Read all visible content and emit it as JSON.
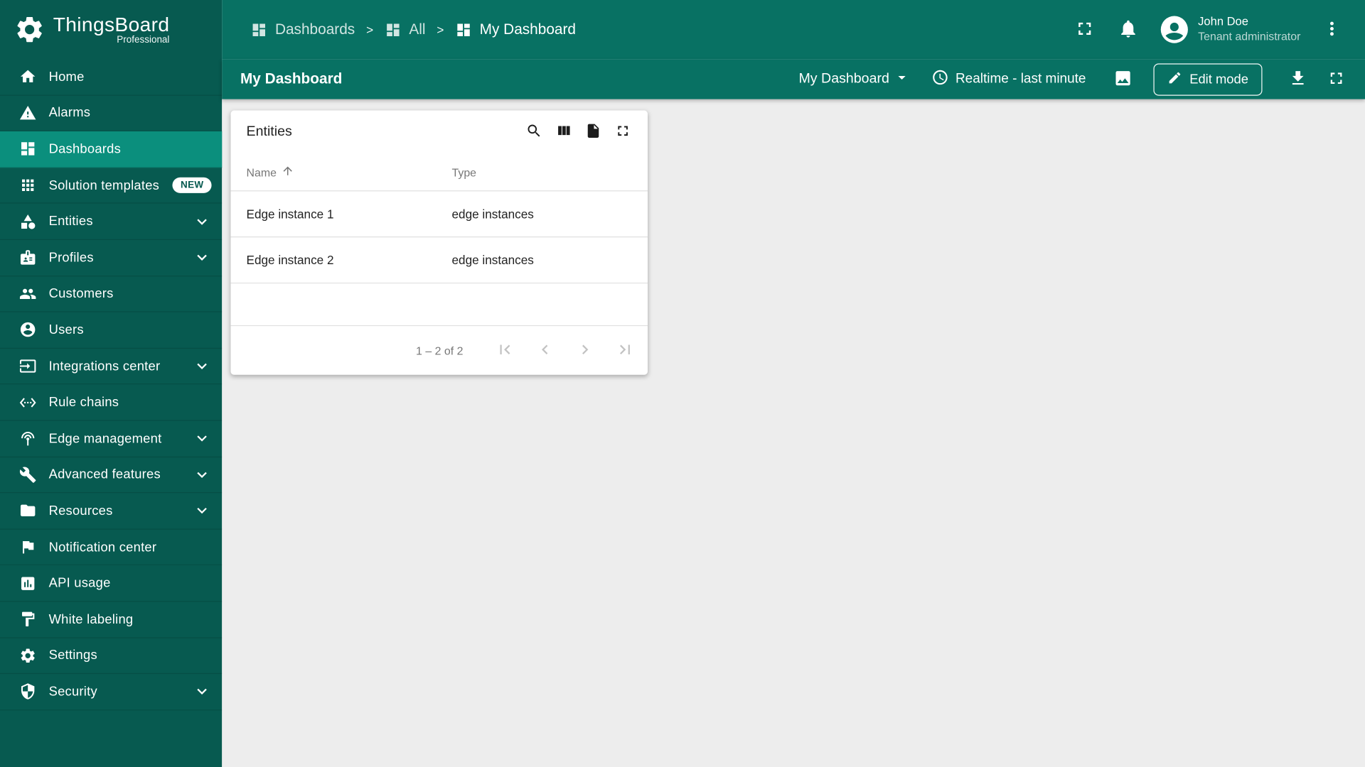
{
  "colors": {
    "sidebar_bg": "#075a50",
    "topbar_bg": "#087163",
    "active_bg": "#0b8f7d",
    "content_bg": "#ededed",
    "badge_text": "#075a50"
  },
  "app": {
    "logo_title": "ThingsBoard",
    "logo_subtitle": "Professional"
  },
  "sidebar": {
    "items": [
      {
        "label": "Home"
      },
      {
        "label": "Alarms"
      },
      {
        "label": "Dashboards"
      },
      {
        "label": "Solution templates",
        "badge": "NEW"
      },
      {
        "label": "Entities"
      },
      {
        "label": "Profiles"
      },
      {
        "label": "Customers"
      },
      {
        "label": "Users"
      },
      {
        "label": "Integrations center"
      },
      {
        "label": "Rule chains"
      },
      {
        "label": "Edge management"
      },
      {
        "label": "Advanced features"
      },
      {
        "label": "Resources"
      },
      {
        "label": "Notification center"
      },
      {
        "label": "API usage"
      },
      {
        "label": "White labeling"
      },
      {
        "label": "Settings"
      },
      {
        "label": "Security"
      }
    ]
  },
  "breadcrumb": {
    "separator": ">",
    "items": [
      {
        "label": "Dashboards"
      },
      {
        "label": "All"
      },
      {
        "label": "My Dashboard"
      }
    ]
  },
  "user": {
    "name": "John Doe",
    "role": "Tenant administrator"
  },
  "toolbar": {
    "title": "My Dashboard",
    "dashboard_selector": "My Dashboard",
    "timewindow": "Realtime - last minute",
    "edit_button": "Edit mode"
  },
  "widget": {
    "title": "Entities",
    "columns": {
      "name": "Name",
      "type": "Type"
    },
    "rows": [
      {
        "name": "Edge instance 1",
        "type": "edge instances"
      },
      {
        "name": "Edge instance 2",
        "type": "edge instances"
      }
    ],
    "pagination": {
      "range_label": "1 – 2 of 2"
    }
  }
}
